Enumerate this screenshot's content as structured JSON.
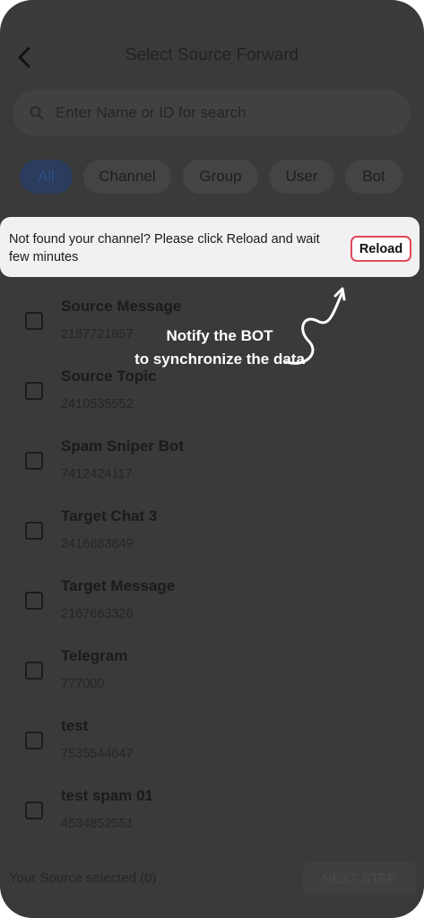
{
  "header": {
    "title": "Select Source Forward"
  },
  "search": {
    "placeholder": "Enter Name or ID for search"
  },
  "filters": [
    "All",
    "Channel",
    "Group",
    "User",
    "Bot"
  ],
  "banner": {
    "text": "Not found your channel? Please click Reload and wait few minutes",
    "button": "Reload"
  },
  "annotation": {
    "line1": "Notify the BOT",
    "line2": "to synchronize the data"
  },
  "items": [
    {
      "name": "Source Message",
      "id": "2187721857"
    },
    {
      "name": "Source Topic",
      "id": "2410535552"
    },
    {
      "name": "Spam Sniper Bot",
      "id": "7412424117"
    },
    {
      "name": "Target Chat 3",
      "id": "2416683849"
    },
    {
      "name": "Target Message",
      "id": "2167663326"
    },
    {
      "name": "Telegram",
      "id": "777000"
    },
    {
      "name": "test",
      "id": "7535544647"
    },
    {
      "name": "test spam 01",
      "id": "4534852551"
    }
  ],
  "footer": {
    "selected_text": "Your Source selected (0)",
    "next_button": "NEXT STEP"
  },
  "colors": {
    "overlay": "#3a3a3a",
    "banner_bg": "#f1f1f1",
    "reload_border": "#e0485a",
    "active_chip": "#2a3d5e"
  }
}
